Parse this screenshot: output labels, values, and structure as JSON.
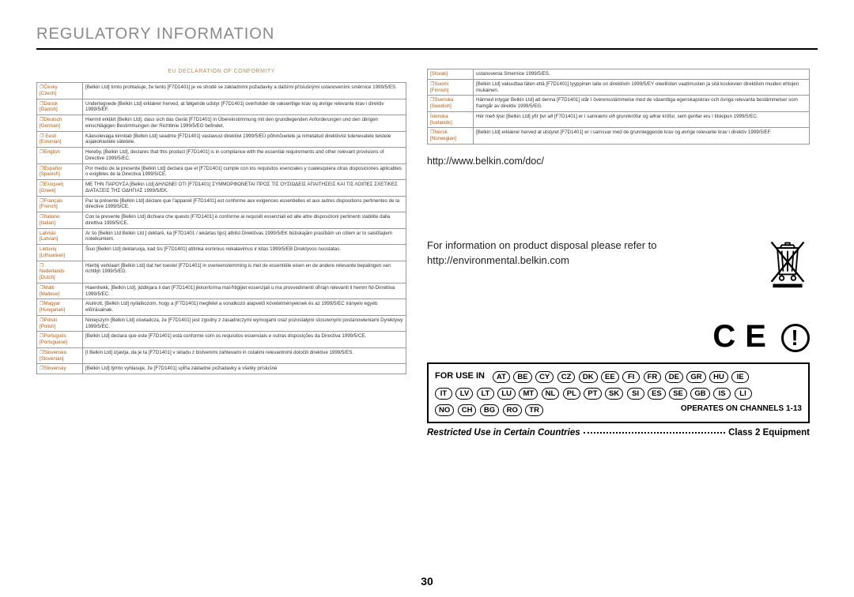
{
  "title": "REGULATORY INFORMATION",
  "declaration_title": "EU DECLARATION OF CONFORMITY",
  "left_rows": [
    {
      "lang": "❐Česky\n[Czech]",
      "text": "[Belkin Ltd] tímto prohlašuje, že tento [F7D1401] je ve shodě se základními požadavky a dalšími příslušnými ustanoveními směrnice 1999/5/ES."
    },
    {
      "lang": "❐Dansk\n[Danish]",
      "text": "Undertegnede [Belkin Ltd] erklærer herved, at følgende udstyr [F7D1401] overholder de væsentlige krav og øvrige relevante krav i direktiv 1999/5/EF."
    },
    {
      "lang": "❐Deutsch\n[German]",
      "text": "Hiermit erklärt [Belkin Ltd], dass sich das Gerät [F7D1401] in Übereinstimmung mit den grundlegenden Anforderungen und den übrigen einschlägigen Bestimmungen der Richtlinie 1999/5/EG befindet."
    },
    {
      "lang": "❐ Eesti\n[Estonian]",
      "text": "Käesolevaga kinnitab [Belkin Ltd] seadme [F7D1401] vastavust direktiivi 1999/5/EÜ põhinõuetele ja nimetatud direktiivist tulenevatele teistele asjakohastele sätetele."
    },
    {
      "lang": "❐English",
      "text": "Hereby, [Belkin Ltd], declares that this product [F7D1401] is in compliance with the essential requirements and other relevant provisions of Directive 1999/5/EC."
    },
    {
      "lang": "❐Español\n[Spanish]",
      "text": "Por medio de la presente [Belkin Ltd] declara que el [F7D1401] cumple con los requisitos esenciales y cualesquiera otras disposiciones aplicables o exigibles de la Directiva 1999/5/CE."
    },
    {
      "lang": "❐Ελληνική\n[Greek]",
      "text": "ΜΕ ΤΗΝ ΠΑΡΟΥΣΑ [Belkin Ltd] ΔΗΛΩΝΕΙ ΟΤΙ [F7D1401] ΣΥΜΜΟΡΦΩΝΕΤΑΙ ΠΡΟΣ ΤΙΣ ΟΥΣΙΩΔΕΙΣ ΑΠΑΙΤΗΣΕΙΣ ΚΑΙ ΤΙΣ ΛΟΙΠΕΣ ΣΧΕΤΙΚΕΣ ΔΙΑΤΑΞΕΙΣ ΤΗΣ ΟΔΗΓΙΑΣ 1999/5/ΕΚ."
    },
    {
      "lang": "❐Français\n[French]",
      "text": "Par la présente [Belkin Ltd] déclare que l'appareil [F7D1401] est conforme aux exigences essentielles et aux autres dispositions pertinentes de la directive 1999/5/CE."
    },
    {
      "lang": "❐Italiano\n[Italian]",
      "text": "Con la presente [Belkin Ltd] dichiara che questo [F7D1401] è conforme ai requisiti essenziali ed alle altre disposizioni pertinenti stabilite dalla direttiva 1999/5/CE."
    },
    {
      "lang": "Latviski\n[Latvian]",
      "text": "Ar šo [Belkin Ltd Belkin Ltd ] deklarē, ka [F7D1401 / iekārtas tips] atbilst Direktīvas 1999/5/EK būtiskajām prasībām un citiem ar to saistītajiem noteikumiem."
    },
    {
      "lang": "Lietuvių\n[Lithuanian]",
      "text": "Šiuo [Belkin Ltd] deklaruoja, kad šis [F7D1401] atitinka esminius reikalavimus ir kitas 1999/5/EB Direktyvos nuostatas."
    },
    {
      "lang": "❐\nNederlands\n[Dutch]",
      "text": "Hierbij verklaart [Belkin Ltd] dat het toestel [F7D1401] in overeenstemming is met de essentiële eisen en de andere relevante bepalingen van richtlijn 1999/5/EG."
    },
    {
      "lang": "❐Malti\n[Maltese]",
      "text": "Hawnhekk, [Belkin Ltd], jiddikjara li dan [F7D1401] jikkonforma mal-ħtiġijiet essenzjali u ma provvedimenti oħrajn relevanti li hemm fid-Dirrettiva 1999/5/EC."
    },
    {
      "lang": "❐Magyar\n[Hungarian]",
      "text": "Alulírott, [Belkin Ltd] nyilatkozom, hogy a [F7D1401] megfelel a vonatkozó alapvetõ követelményeknek és az 1999/5/EC irányelv egyéb elõírásainak."
    },
    {
      "lang": "❐Polski\n[Polish]",
      "text": "Niniejszym [Belkin Ltd] oświadcza, że [F7D1401] jest zgodny z zasadniczymi wymogami oraz pozostałymi stosownymi postanowieniami Dyrektywy 1999/5/EC."
    },
    {
      "lang": "❐Português\n[Portuguese]",
      "text": "[Belkin Ltd] declara que este [F7D1401] está conforme com os requisitos essenciais e outras disposições da Directiva 1999/5/CE."
    },
    {
      "lang": "❐Slovensko\n[Slovenian]",
      "text": "[I Belkin Ltd] izjavlja, da je ta [F7D1401] v skladu z bistvenimi zahtevami in ostalimi relevantnimi določili direktive 1999/5/ES."
    },
    {
      "lang": "❐Slovensky",
      "text": "[Belkin Ltd] týmto vyhlasuje, že [F7D1401] spĺňa základné požiadavky a všetky príslušné"
    }
  ],
  "right_rows": [
    {
      "lang": "[Slovak]",
      "text": "ustanovenia Smernice 1999/5/ES."
    },
    {
      "lang": "❐Suomi\n[Finnish]",
      "text": "[Belkin Ltd] vakuuttaa täten että [F7D1401] tyyppinen laite on direktiivin 1999/5/EY oleellisten vaatimusten ja sitä koskevien direktiivin muiden ehtojen mukainen."
    },
    {
      "lang": "❐Svenska\n[Swedish]",
      "text": "Härmed intygar Belkin Ltd] att denna [F7D1401] står I överensstämmelse med de väsentliga egenskapskrav och övriga relevanta bestämmelser som framgår av direktiv 1999/5/EG."
    },
    {
      "lang": "Íslenska\n[Icelandic]",
      "text": "Hér með lýsir [Belkin Ltd] yfir því að [F7D1401] er í samræmi við grunnkröfur og aðrar kröfur, sem gerðar eru í tilskipun 1999/5/EC."
    },
    {
      "lang": "❐Norsk\n[Norwegian]",
      "text": "[Belkin Ltd] erklærer herved at utstyret [F7D1401] er i samsvar med de grunnleggende krav og øvrige relevante krav i direktiv 1999/5/EF."
    }
  ],
  "url": "http://www.belkin.com/doc/",
  "disposal_line1": "For information on product disposal please refer to",
  "disposal_line2": "http://environmental.belkin.com",
  "for_use_label": "FOR USE IN",
  "countries_row1": [
    "AT",
    "BE",
    "CY",
    "CZ",
    "DK",
    "EE",
    "FI",
    "FR",
    "DE",
    "GR",
    "HU",
    "IE"
  ],
  "countries_row2": [
    "IT",
    "LV",
    "LT",
    "LU",
    "MT",
    "NL",
    "PL",
    "PT",
    "SK",
    "SI",
    "ES",
    "SE",
    "GB",
    "IS",
    "LI"
  ],
  "countries_row3": [
    "NO",
    "CH",
    "BG",
    "RO",
    "TR"
  ],
  "operates_label": "OPERATES ON CHANNELS 1-13",
  "restricted_label": "Restricted Use in Certain Countries",
  "class_label": "Class 2 Equipment",
  "page_number": "30"
}
